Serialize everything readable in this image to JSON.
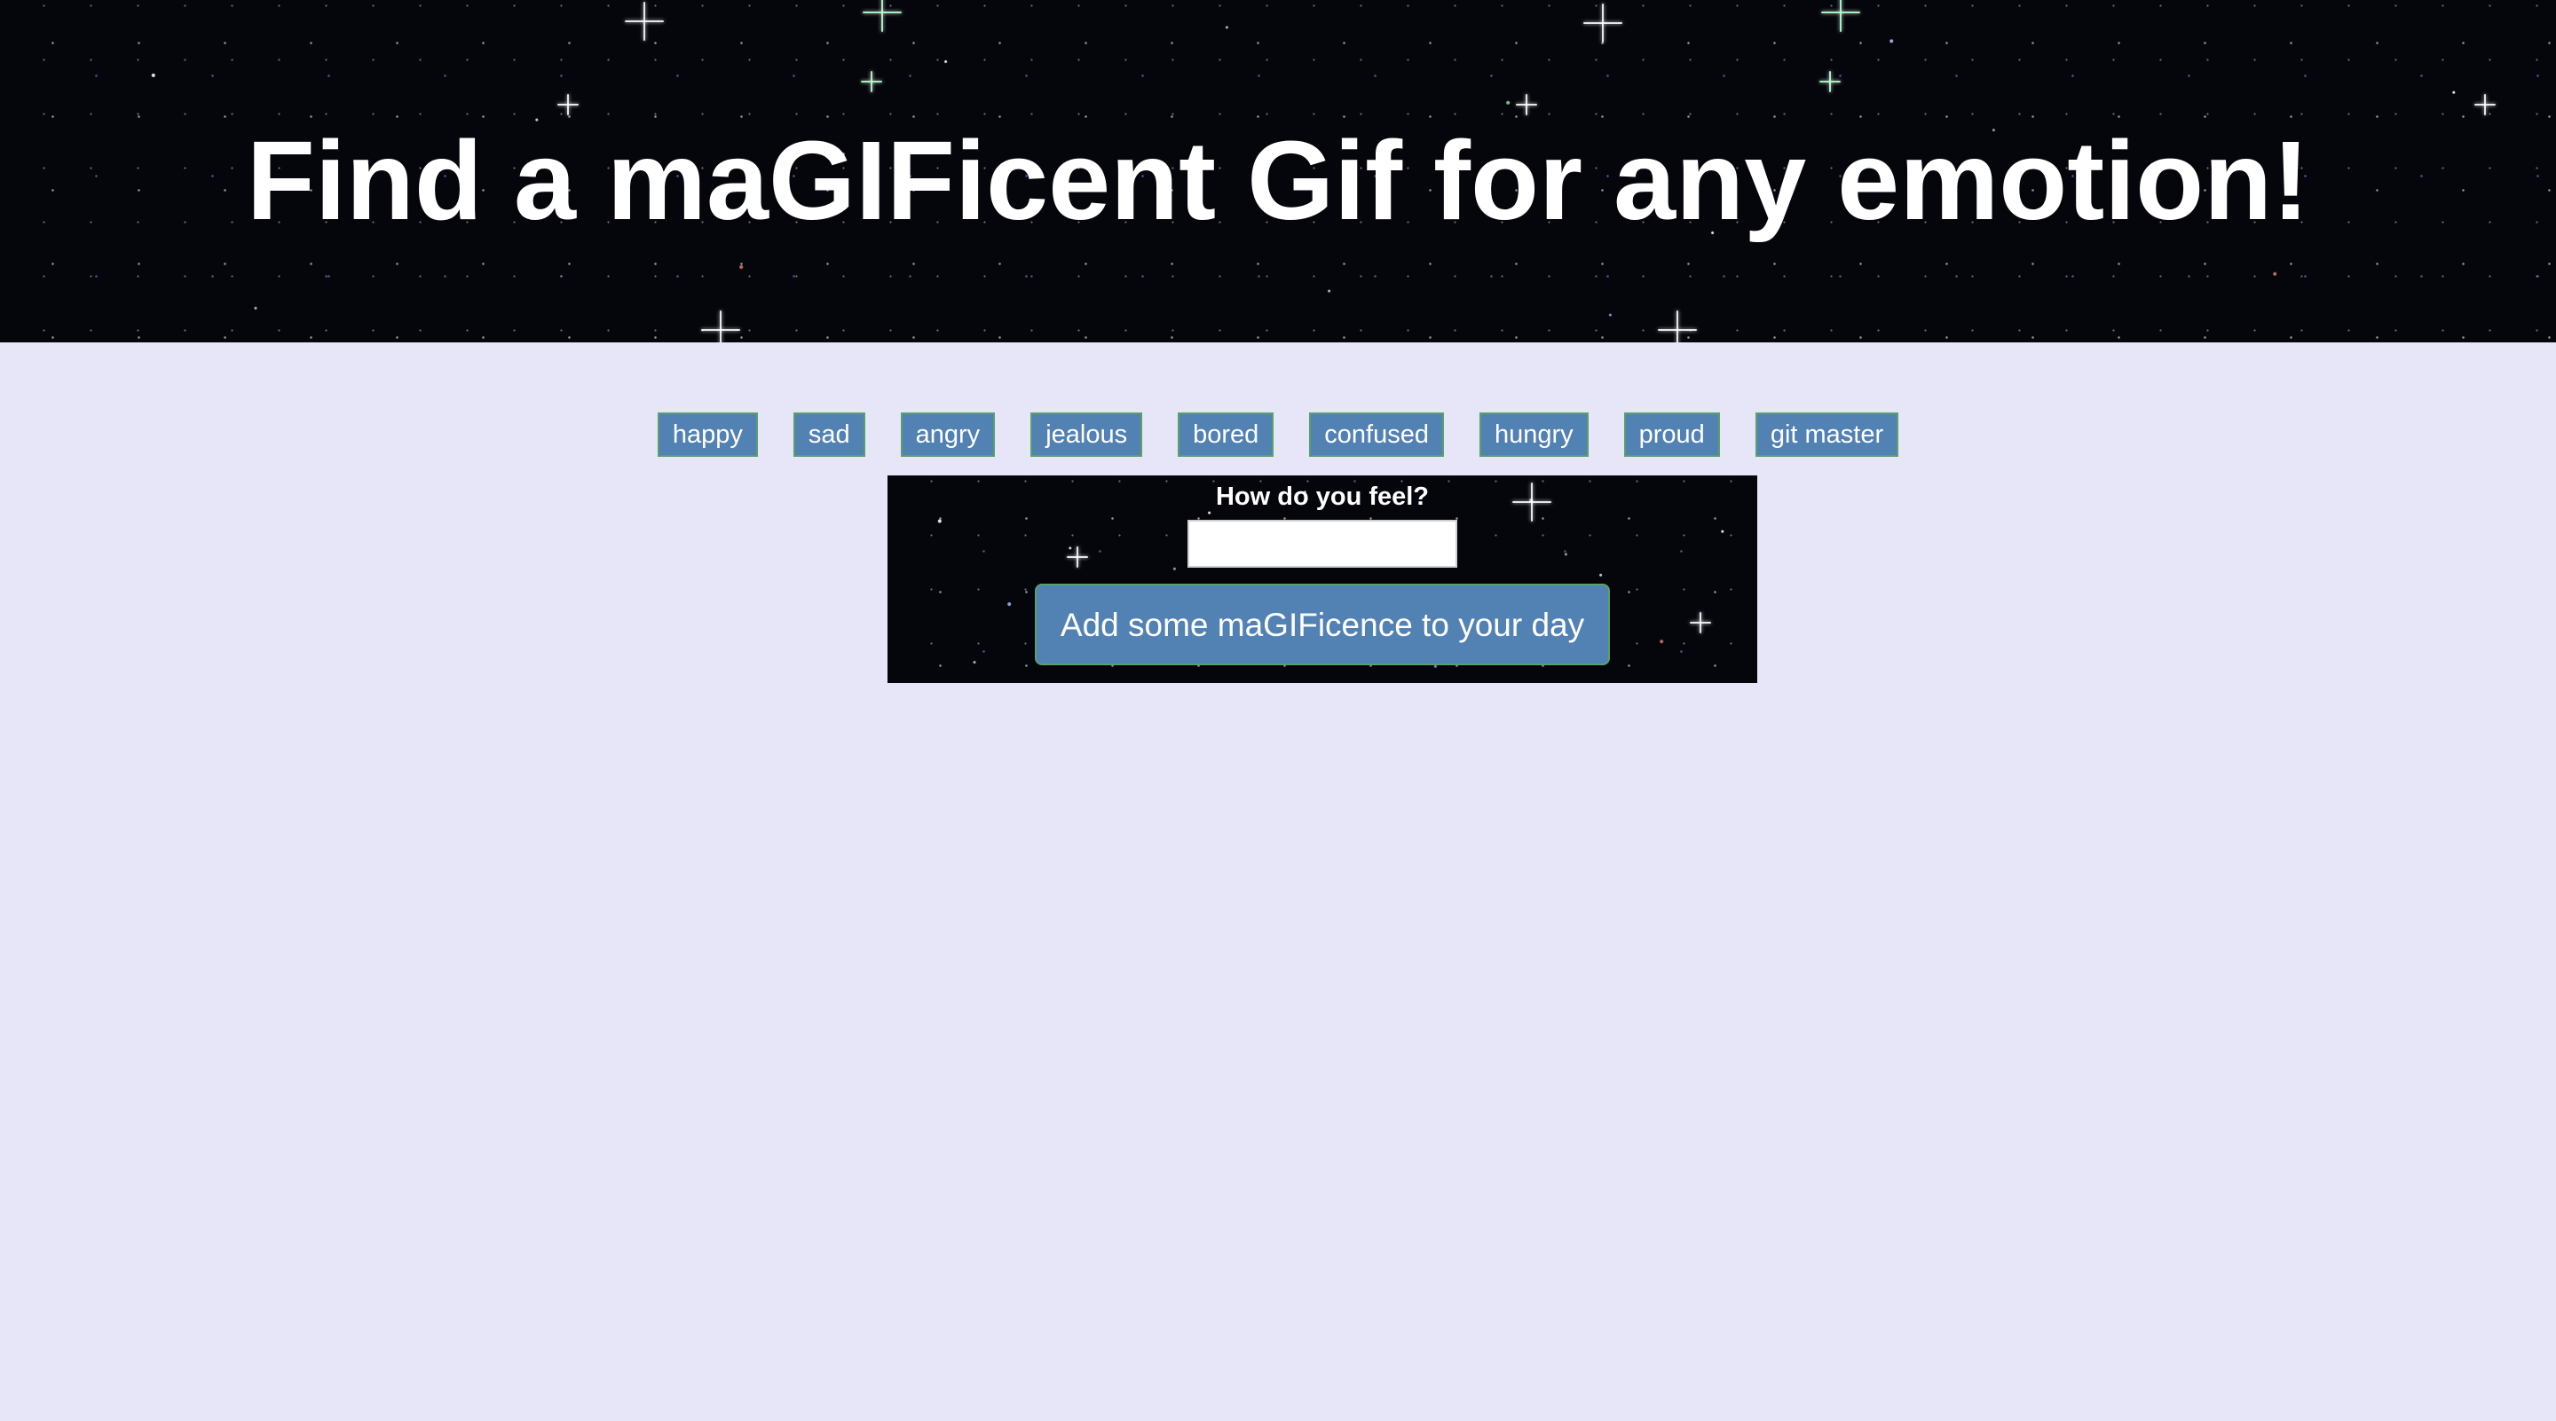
{
  "header": {
    "title": "Find a maGIFicent Gif for any emotion!"
  },
  "emotions": [
    {
      "label": "happy"
    },
    {
      "label": "sad"
    },
    {
      "label": "angry"
    },
    {
      "label": "jealous"
    },
    {
      "label": "bored"
    },
    {
      "label": "confused"
    },
    {
      "label": "hungry"
    },
    {
      "label": "proud"
    },
    {
      "label": "git master"
    }
  ],
  "form": {
    "label": "How do you feel?",
    "input_value": "",
    "submit_label": "Add some maGIFicence to your day"
  },
  "colors": {
    "page_background": "#e6e6f8",
    "button_background": "#5281b3",
    "button_border": "#5aa06a",
    "starfield": "#05060c",
    "text_light": "#ffffff"
  }
}
